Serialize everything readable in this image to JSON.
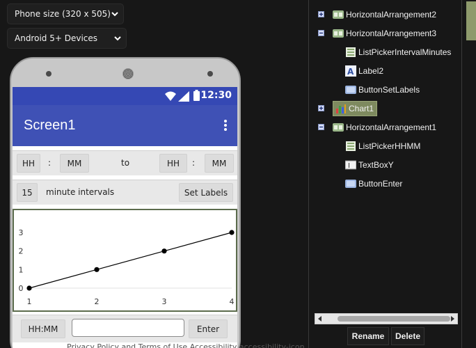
{
  "toolbar": {
    "phone_size": "Phone size (320 x 505)",
    "device": "Android 5+ Devices"
  },
  "phone": {
    "status_time": "12:30",
    "screen_title": "Screen1",
    "row1": {
      "hh1": "HH",
      "sep1": ":",
      "mm1": "MM",
      "to": "to",
      "hh2": "HH",
      "sep2": ":",
      "mm2": "MM"
    },
    "row2": {
      "interval_value": "15",
      "interval_label": "minute intervals",
      "set_labels": "Set Labels"
    },
    "row3": {
      "hhmm": "HH:MM",
      "enter": "Enter"
    }
  },
  "chart_data": {
    "type": "line",
    "x": [
      1,
      2,
      3,
      4
    ],
    "values": [
      0,
      1,
      2,
      3
    ],
    "xticks": [
      "1",
      "2",
      "3",
      "4"
    ],
    "yticks": [
      "0",
      "1",
      "2",
      "3"
    ],
    "xlim": [
      1,
      4
    ],
    "ylim": [
      0,
      3
    ],
    "line_color": "#000000"
  },
  "tree": {
    "items": [
      {
        "label": "HorizontalArrangement2",
        "toggle": "plus",
        "icon": "arrangement-icon"
      },
      {
        "label": "HorizontalArrangement3",
        "toggle": "minus",
        "icon": "arrangement-icon"
      },
      {
        "label": "ListPickerIntervalMinutes",
        "icon": "listpicker-icon"
      },
      {
        "label": "Label2",
        "icon": "label-icon"
      },
      {
        "label": "ButtonSetLabels",
        "icon": "button-icon"
      },
      {
        "label": "Chart1",
        "toggle": "plus",
        "icon": "chart-icon",
        "selected": true
      },
      {
        "label": "HorizontalArrangement1",
        "toggle": "minus",
        "icon": "arrangement-icon"
      },
      {
        "label": "ListPickerHHMM",
        "icon": "listpicker-icon"
      },
      {
        "label": "TextBoxY",
        "icon": "textbox-icon"
      },
      {
        "label": "ButtonEnter",
        "icon": "button-icon"
      }
    ],
    "rename": "Rename",
    "delete": "Delete"
  },
  "footer": {
    "text": "Privacy Policy and Terms of Use   Accessibility   accessibility-icon"
  },
  "colors": {
    "appbar": "#3f51b5",
    "statusbar": "#3548b4",
    "selected": "#7e8a5f"
  }
}
